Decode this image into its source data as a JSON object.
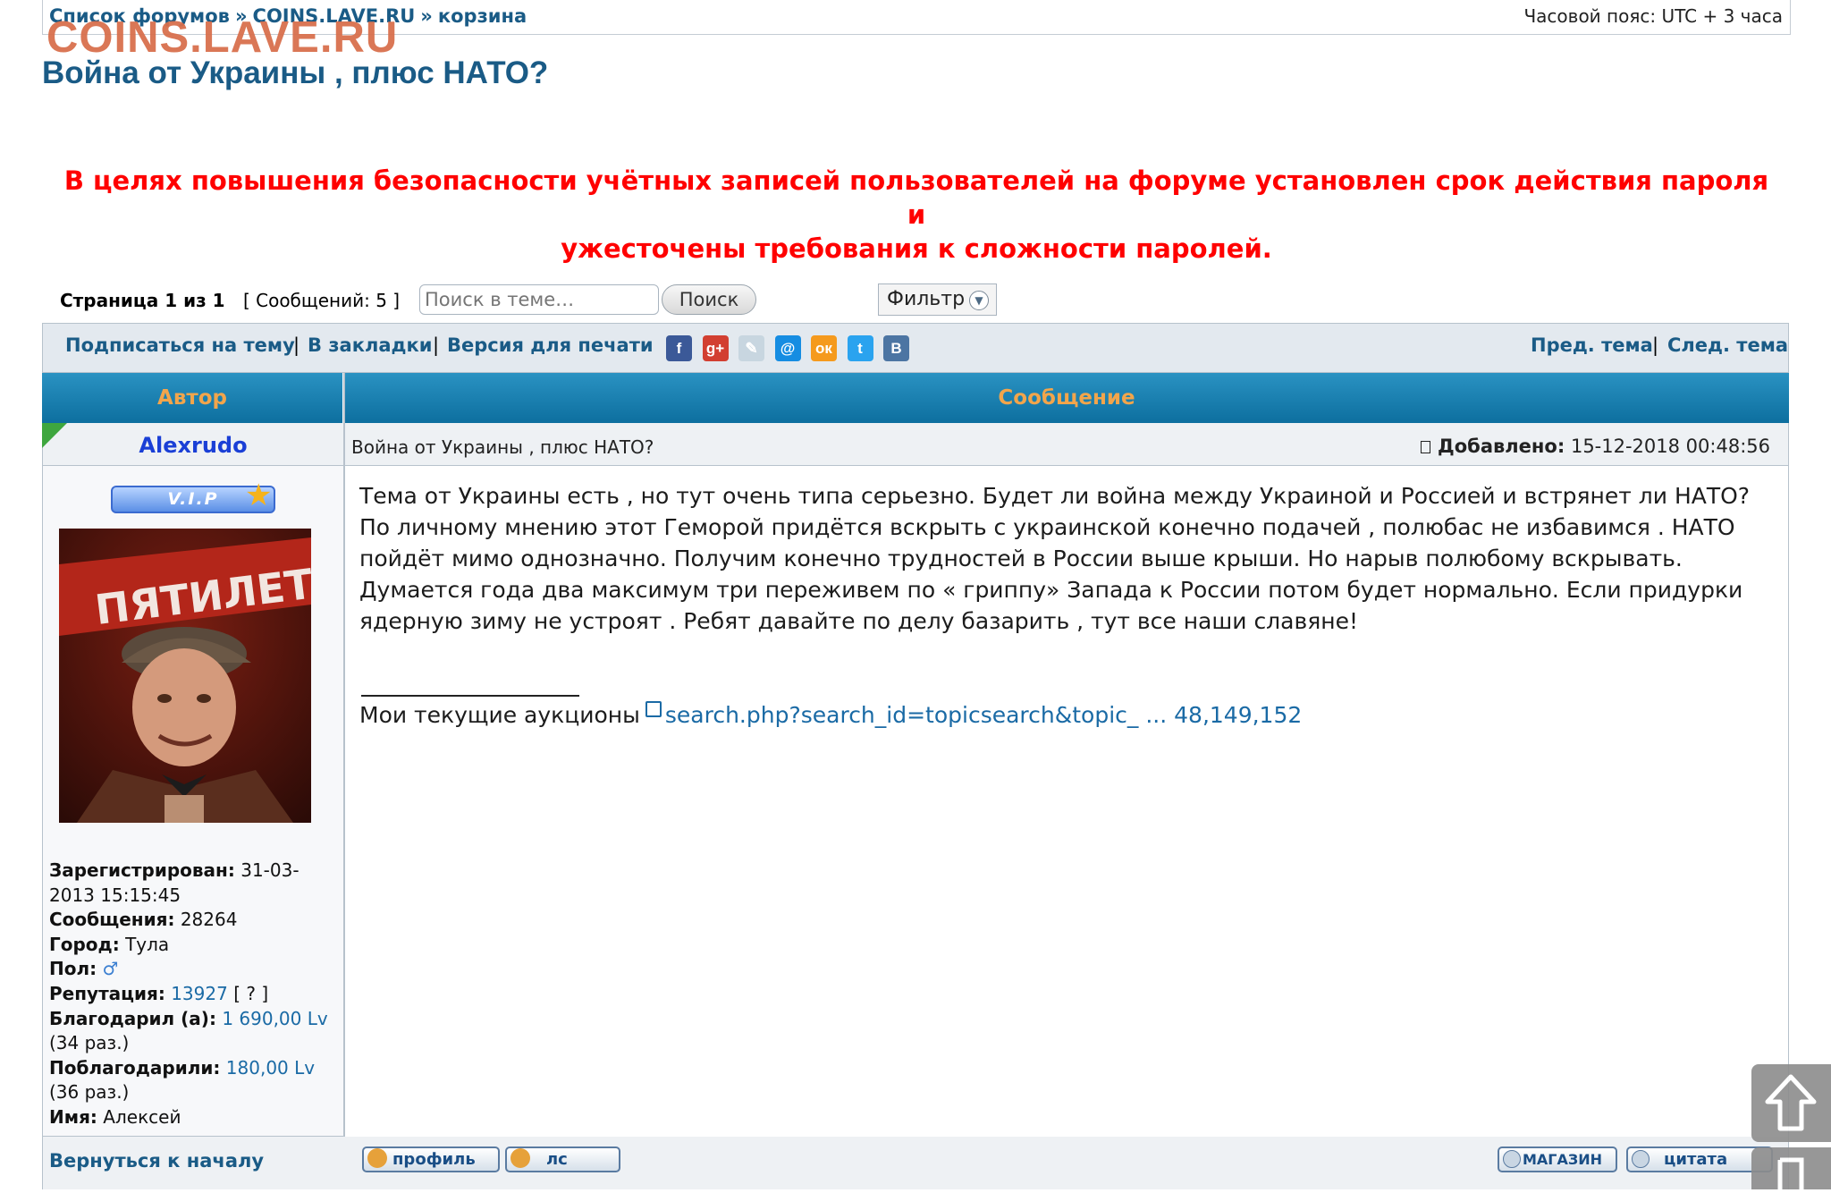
{
  "breadcrumb": {
    "items": [
      "Список форумов",
      "COINS.LAVE.RU",
      "корзина"
    ],
    "separator": "»"
  },
  "timezone": "Часовой пояс: UTC + 3 часа",
  "logo_text": "COINS.LAVE.RU",
  "topic_title": "Война от Украины , плюс НАТО?",
  "notice": {
    "line1": "В целях повышения безопасности учётных записей пользователей на форуме установлен срок действия пароля и",
    "line2": "ужесточены требования к сложности паролей.",
    "color": "#ff0000"
  },
  "pagination": {
    "page_label": "Страница 1 из 1",
    "messages_count": "[ Сообщений: 5 ]"
  },
  "search": {
    "placeholder": "Поиск в теме…",
    "button_label": "Поиск"
  },
  "filter_label": "Фильтр",
  "actions": {
    "subscribe": "Подписаться на тему",
    "bookmarks": "В закладки",
    "print": "Версия для печати",
    "prev_topic": "Пред. тема",
    "next_topic": "След. тема",
    "separator": "|"
  },
  "social_icons": [
    {
      "name": "facebook-icon",
      "glyph": "f",
      "color": "#3b5998"
    },
    {
      "name": "google-plus-icon",
      "glyph": "g+",
      "color": "#d23f31"
    },
    {
      "name": "livejournal-icon",
      "glyph": "✎",
      "color": "#c8d6e0"
    },
    {
      "name": "mail-ru-icon",
      "glyph": "@",
      "color": "#168de2"
    },
    {
      "name": "odnoklassniki-icon",
      "glyph": "ок",
      "color": "#f59a1d"
    },
    {
      "name": "twitter-icon",
      "glyph": "t",
      "color": "#2aa3ef"
    },
    {
      "name": "vkontakte-icon",
      "glyph": "В",
      "color": "#4c75a3"
    }
  ],
  "table": {
    "author_header": "Автор",
    "message_header": "Сообщение"
  },
  "post": {
    "author": "Alexrudo",
    "subject": "Война от Украины , плюс НАТО?",
    "date_label": "Добавлено:",
    "date": "15-12-2018 00:48:56",
    "badge": "V.I.P",
    "body": "Тема от Украины есть , но тут очень типа серьезно. Будет ли война между Украиной и Россией и встрянет ли НАТО? По личному мнению этот Геморой придётся вскрыть с украинской конечно подачей , полюбас не избавимся . НАТО пойдёт мимо однозначно. Получим конечно трудностей в России выше крыши. Но нарыв полюбому вскрывать. Думается года два максимум три переживем по « гриппу» Запада к России потом будет нормально. Если придурки ядерную зиму не устроят . Ребят давайте по делу базарить , тут все наши славяне!",
    "signature_text": "Мои текущие аукционы",
    "signature_link": "search.php?search_id=topicsearch&topic_ ... 48,149,152",
    "avatar_banner_text": "ПЯТИЛЕТК"
  },
  "profile": {
    "registered_label": "Зарегистрирован:",
    "registered": "31-03-2013 15:15:45",
    "messages_label": "Сообщения:",
    "messages": "28264",
    "city_label": "Город:",
    "city": "Тула",
    "gender_label": "Пол:",
    "gender_icon": "male-icon",
    "reputation_label": "Репутация:",
    "reputation": "13927",
    "reputation_help": "[ ? ]",
    "thanked_label": "Благодарил (а):",
    "thanked": "1 690,00 Lv",
    "thanked_times": "(34 раз.)",
    "was_thanked_label": "Поблагодарили:",
    "was_thanked": "180,00 Lv",
    "was_thanked_times": "(36 раз.)",
    "name_label": "Имя:",
    "name": "Алексей"
  },
  "footer_row": {
    "back_to_top": "Вернуться к началу",
    "profile_button": "профиль",
    "pm_button": "лс",
    "shop_button": "МАГАЗИН",
    "quote_button": "цитата"
  }
}
